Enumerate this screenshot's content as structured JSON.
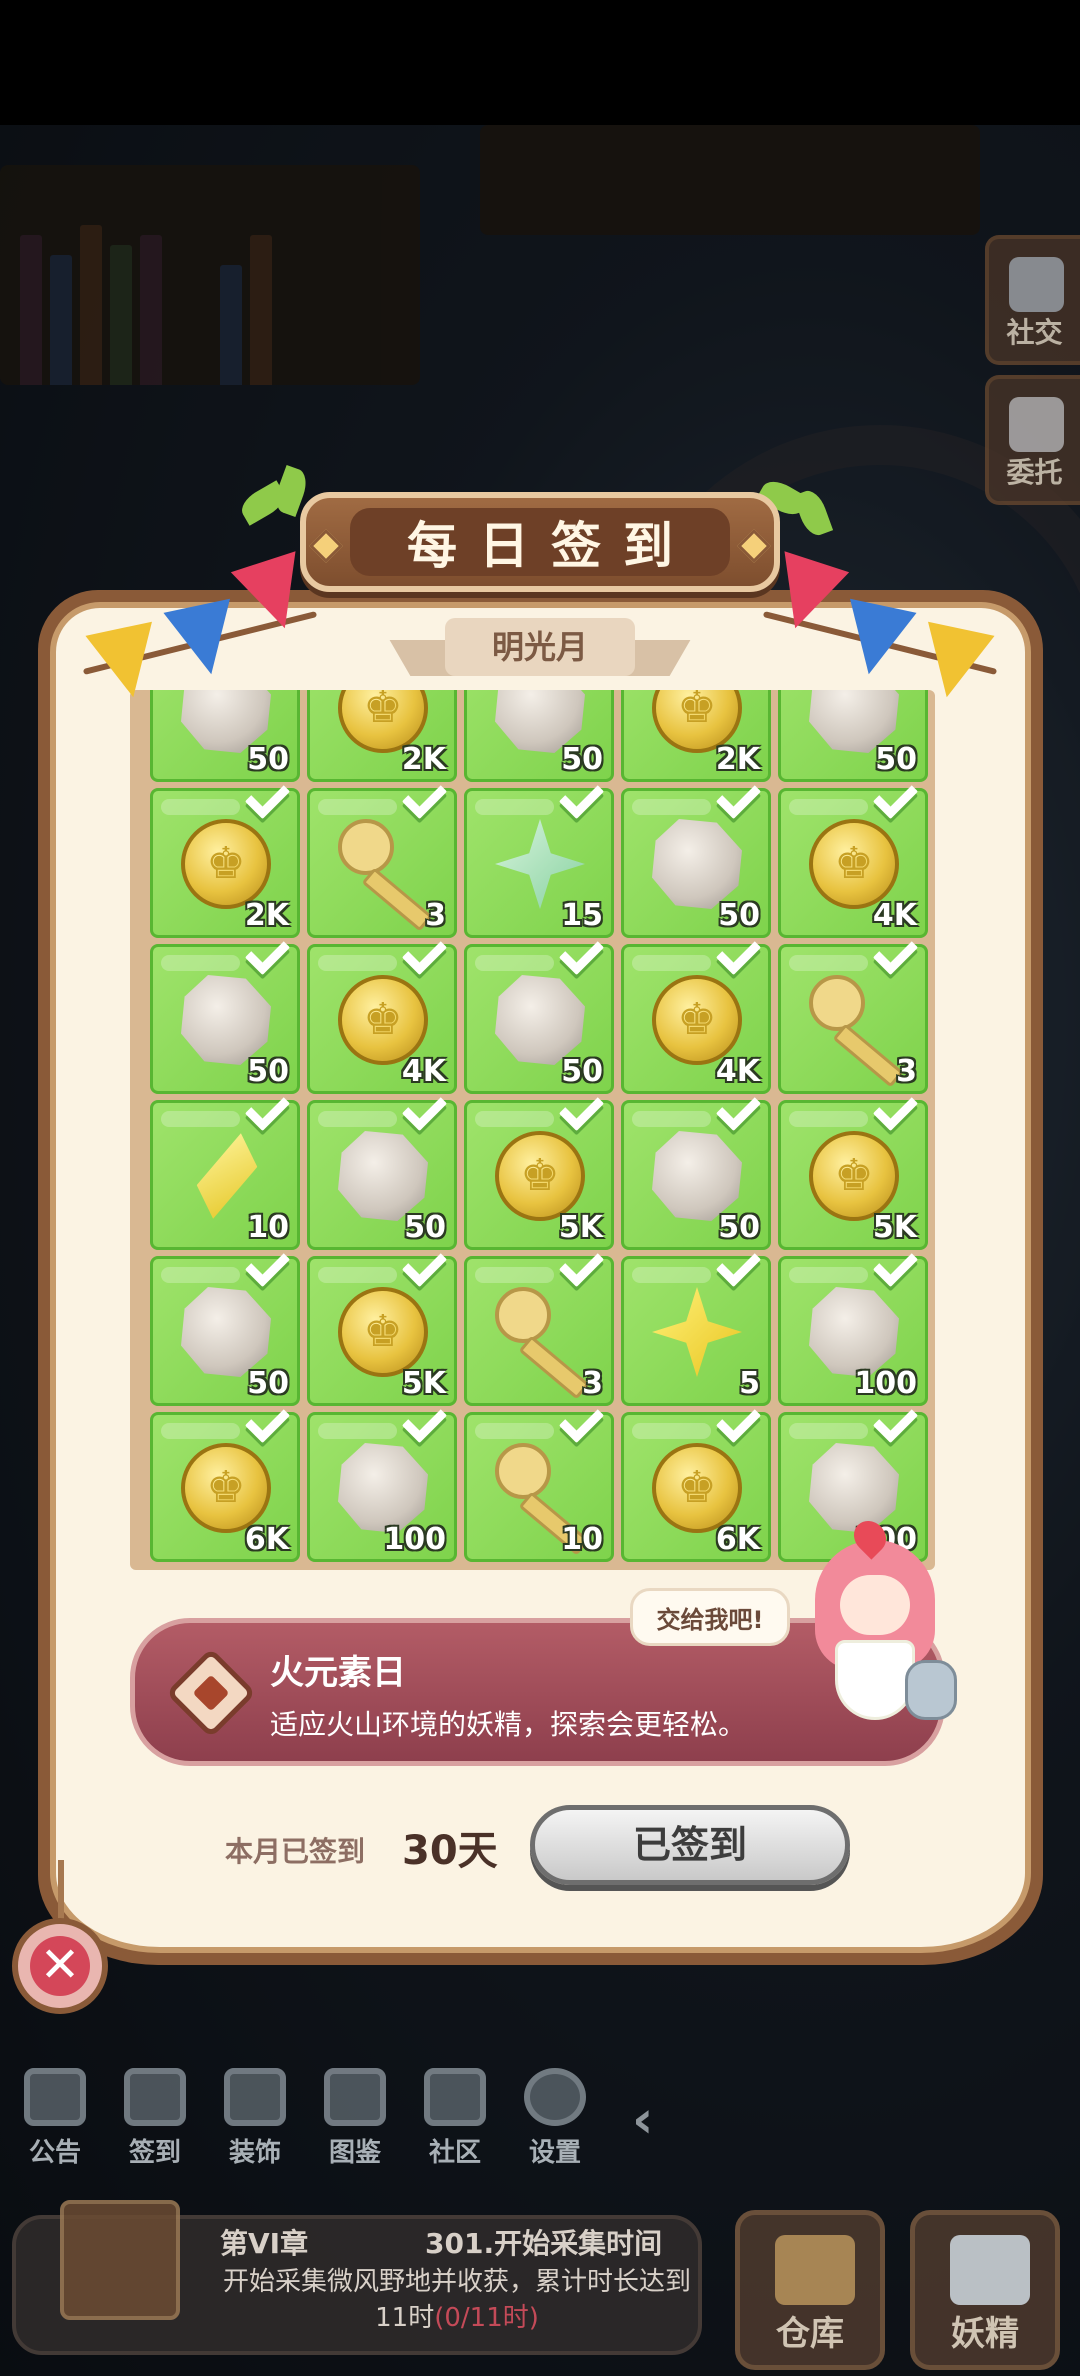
{
  "side_menu": [
    {
      "label": "社交",
      "icon": "social-icon"
    },
    {
      "label": "委托",
      "icon": "qr-commission-icon"
    }
  ],
  "dialog": {
    "title": "每日签到",
    "month": "明光月",
    "rows": [
      [
        {
          "item": "stone",
          "qty": "50"
        },
        {
          "item": "coin",
          "qty": "2K"
        },
        {
          "item": "stone",
          "qty": "50"
        },
        {
          "item": "coin",
          "qty": "2K"
        },
        {
          "item": "stone",
          "qty": "50"
        }
      ],
      [
        {
          "item": "coin",
          "qty": "2K"
        },
        {
          "item": "key",
          "qty": "3"
        },
        {
          "item": "star",
          "qty": "15"
        },
        {
          "item": "stone",
          "qty": "50"
        },
        {
          "item": "coin",
          "qty": "4K"
        }
      ],
      [
        {
          "item": "stone",
          "qty": "50"
        },
        {
          "item": "coin",
          "qty": "4K"
        },
        {
          "item": "stone",
          "qty": "50"
        },
        {
          "item": "coin",
          "qty": "4K"
        },
        {
          "item": "key",
          "qty": "3"
        }
      ],
      [
        {
          "item": "diamond",
          "qty": "10"
        },
        {
          "item": "stone",
          "qty": "50"
        },
        {
          "item": "coin",
          "qty": "5K"
        },
        {
          "item": "stone",
          "qty": "50"
        },
        {
          "item": "coin",
          "qty": "5K"
        }
      ],
      [
        {
          "item": "stone",
          "qty": "50"
        },
        {
          "item": "coin",
          "qty": "5K"
        },
        {
          "item": "key",
          "qty": "3"
        },
        {
          "item": "star gold",
          "qty": "5"
        },
        {
          "item": "stone",
          "qty": "100"
        }
      ],
      [
        {
          "item": "coin",
          "qty": "6K"
        },
        {
          "item": "stone",
          "qty": "100"
        },
        {
          "item": "key",
          "qty": "10"
        },
        {
          "item": "coin",
          "qty": "6K"
        },
        {
          "item": "stone",
          "qty": "100"
        }
      ]
    ],
    "element_day": {
      "title": "火元素日",
      "description": "适应火山环境的妖精，探索会更轻松。"
    },
    "fairy_bubble": "交给我吧!",
    "signed_label": "本月已签到",
    "signed_count": "30天",
    "sign_button": "已签到"
  },
  "toolbar": [
    {
      "label": "公告",
      "icon": "announcement-icon"
    },
    {
      "label": "签到",
      "icon": "calendar-icon"
    },
    {
      "label": "装饰",
      "icon": "decoration-icon"
    },
    {
      "label": "图鉴",
      "icon": "book-icon"
    },
    {
      "label": "社区",
      "icon": "home-icon"
    },
    {
      "label": "设置",
      "icon": "gear-icon"
    }
  ],
  "quest": {
    "chapter": "第VI章",
    "title": "301.开始采集时间",
    "description": "开始采集微风野地并收获，累计时长达到11时",
    "progress": "(0/11时)"
  },
  "corner_buttons": [
    {
      "label": "仓库",
      "icon": "warehouse-chest-icon"
    },
    {
      "label": "妖精",
      "icon": "fairy-icon"
    }
  ]
}
